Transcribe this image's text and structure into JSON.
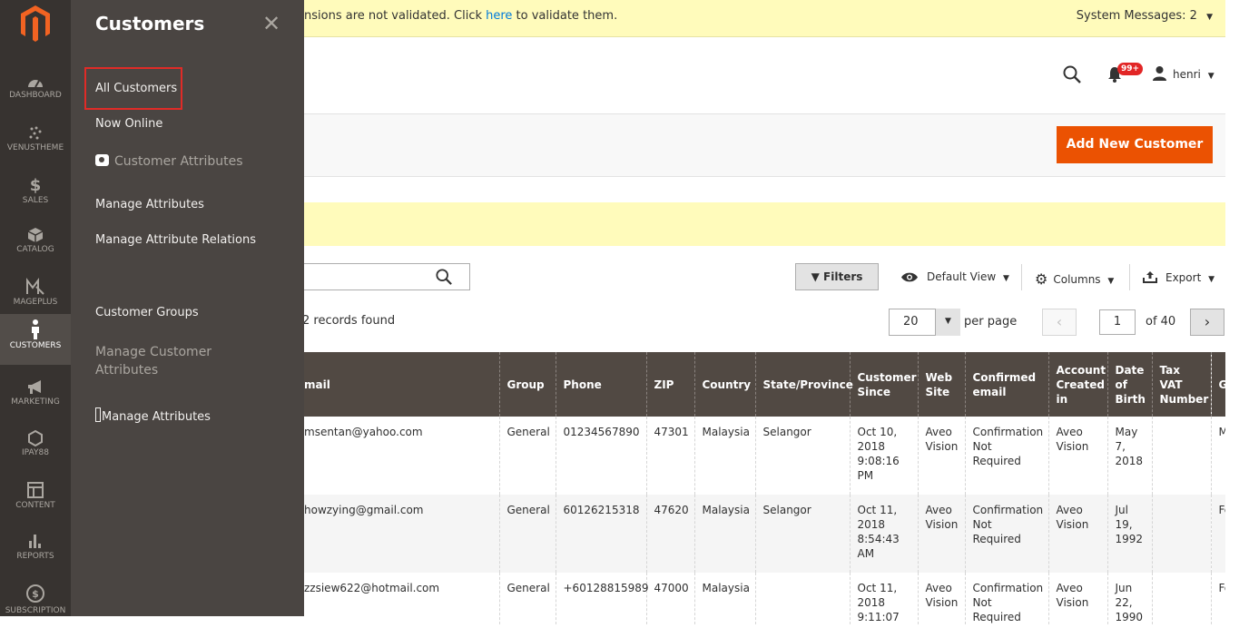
{
  "nav": {
    "items": [
      {
        "label": "DASHBOARD",
        "icon": "dashboard-icon"
      },
      {
        "label": "VENUSTHEME",
        "icon": "venustheme-icon"
      },
      {
        "label": "SALES",
        "icon": "dollar-icon"
      },
      {
        "label": "CATALOG",
        "icon": "cube-icon"
      },
      {
        "label": "MAGEPLUS",
        "icon": "mageplus-icon"
      },
      {
        "label": "CUSTOMERS",
        "icon": "person-icon"
      },
      {
        "label": "MARKETING",
        "icon": "megaphone-icon"
      },
      {
        "label": "IPAY88",
        "icon": "hexagon-icon"
      },
      {
        "label": "CONTENT",
        "icon": "layout-icon"
      },
      {
        "label": "REPORTS",
        "icon": "bar-chart-icon"
      },
      {
        "label": "SUBSCRIPTION",
        "icon": "subscription-icon"
      }
    ]
  },
  "flyout": {
    "title": "Customers",
    "links": {
      "all_customers": "All Customers",
      "now_online": "Now Online",
      "customer_attributes": "Customer Attributes",
      "manage_attributes": "Manage Attributes",
      "manage_attribute_relations": "Manage Attribute Relations",
      "customer_groups": "Customer Groups",
      "manage_customer_attributes": "Manage Customer Attributes",
      "manage_attributes_2": "Manage Attributes"
    }
  },
  "system": {
    "message_prefix": "nsions are not validated. Click ",
    "message_link": "here",
    "message_suffix": " to validate them.",
    "system_messages": "System Messages: 2"
  },
  "header": {
    "notifications_count": "99+",
    "user": "henri"
  },
  "actions": {
    "add_new_customer": "Add New Customer"
  },
  "toolbar": {
    "filters": "Filters",
    "default_view": "Default View",
    "columns": "Columns",
    "export": "Export",
    "records_found": "2 records found",
    "per_page_value": "20",
    "per_page_label": "per page",
    "current_page": "1",
    "total_pages": "of 40"
  },
  "grid": {
    "columns": [
      "mail",
      "Group",
      "Phone",
      "ZIP",
      "Country",
      "State/Province",
      "Customer Since",
      "Web Site",
      "Confirmed email",
      "Account Created in",
      "Date of Birth",
      "Tax VAT Number",
      "G"
    ],
    "rows": [
      [
        "msentan@yahoo.com",
        "General",
        "01234567890",
        "47301",
        "Malaysia",
        "Selangor",
        "Oct 10, 2018 9:08:16 PM",
        "Aveo Vision",
        "Confirmation Not Required",
        "Aveo Vision",
        "May 7, 2018",
        "",
        "M"
      ],
      [
        "howzying@gmail.com",
        "General",
        "60126215318",
        "47620",
        "Malaysia",
        "Selangor",
        "Oct 11, 2018 8:54:43 AM",
        "Aveo Vision",
        "Confirmation Not Required",
        "Aveo Vision",
        "Jul 19, 1992",
        "",
        "Fe"
      ],
      [
        "zzsiew622@hotmail.com",
        "General",
        "+60128815989",
        "47000",
        "Malaysia",
        "",
        "Oct 11, 2018 9:11:07",
        "Aveo Vision",
        "Confirmation Not Required",
        "Aveo Vision",
        "Jun 22, 1990",
        "",
        "Fe"
      ]
    ]
  },
  "colors": {
    "accent": "#eb5202",
    "nav_bg": "#373330",
    "flyout_bg": "#4a4542",
    "header_bg": "#514943",
    "notice_bg": "#fffbbb"
  }
}
